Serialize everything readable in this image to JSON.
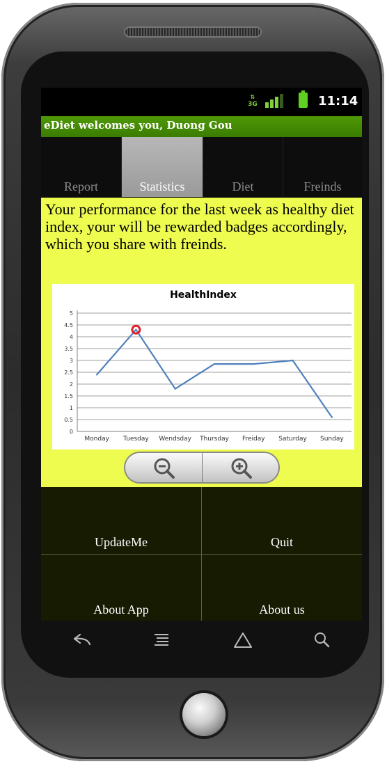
{
  "status_bar": {
    "network": "3G",
    "time": "11:14"
  },
  "app": {
    "title": "eDiet welcomes you, Duong Gou"
  },
  "tabs": [
    {
      "label": "Report",
      "selected": false
    },
    {
      "label": "Statistics",
      "selected": true
    },
    {
      "label": "Diet",
      "selected": false
    },
    {
      "label": "Freinds",
      "selected": false
    }
  ],
  "content": {
    "intro": "Your performance for the last  week as healthy diet index, your will be rewarded badges accordingly, which you share with freinds.",
    "background_color": "#eefc4f"
  },
  "chart_data": {
    "type": "line",
    "title": "HealthIndex",
    "categories": [
      "Monday",
      "Tuesday",
      "Wendsday",
      "Thursday",
      "Freiday",
      "Saturday",
      "Sunday"
    ],
    "series": [
      {
        "values": [
          2.4,
          4.3,
          1.8,
          2.85,
          2.85,
          3.0,
          0.6
        ],
        "color": "#4f81bd"
      }
    ],
    "highlight_index": 1,
    "highlight_color": "#e0202a",
    "yticks": [
      "0",
      "0.5",
      "1",
      "1.5",
      "2",
      "2.5",
      "3",
      "3.5",
      "4",
      "4.5",
      "5"
    ],
    "ylim": [
      0,
      5
    ],
    "grid": true
  },
  "zoom": {
    "out_icon": "zoom-out-icon",
    "in_icon": "zoom-in-icon"
  },
  "menu": [
    {
      "label": "UpdateMe"
    },
    {
      "label": "Quit"
    },
    {
      "label": "About App"
    },
    {
      "label": "About us"
    }
  ],
  "nav_icons": [
    "back-icon",
    "menu-icon",
    "home-icon",
    "search-icon"
  ]
}
